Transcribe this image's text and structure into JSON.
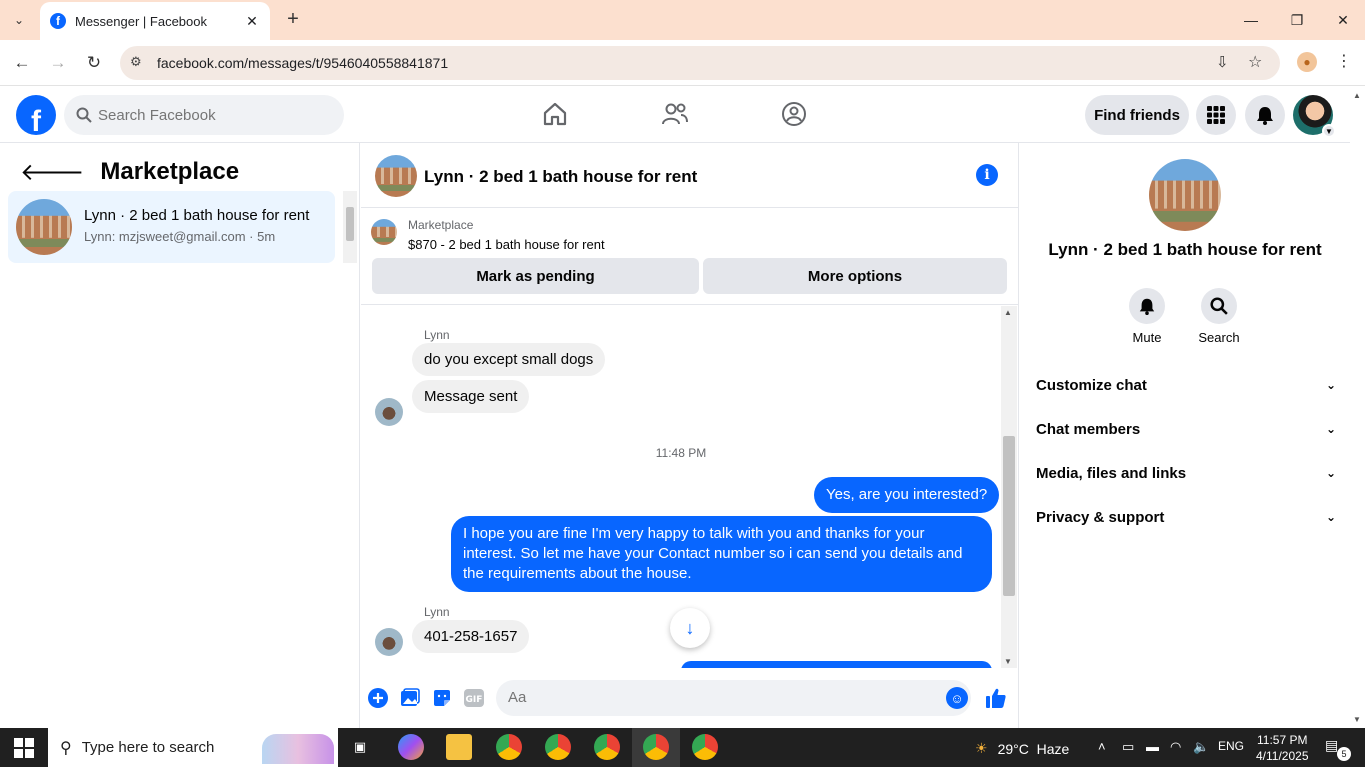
{
  "browser": {
    "tab_title": "Messenger | Facebook",
    "url": "facebook.com/messages/t/9546040558841871"
  },
  "fb_header": {
    "search_placeholder": "Search Facebook",
    "find_friends_label": "Find friends"
  },
  "left_panel": {
    "title": "Marketplace",
    "conversations": [
      {
        "title": "Lynn · 2 bed 1 bath house for rent",
        "preview": "Lynn: mzjsweet@gmail.com · 5m"
      }
    ]
  },
  "chat": {
    "header_name": "Lynn · 2 bed 1 bath house for rent",
    "marketplace_label": "Marketplace",
    "listing": "$870 - 2 bed 1 bath house for rent",
    "mark_pending_label": "Mark as pending",
    "more_options_label": "More options",
    "messages": {
      "sender_1": "Lynn",
      "in_1": "do you except small dogs",
      "in_2": "Message sent",
      "timestamp": "11:48 PM",
      "out_1": "Yes, are you interested?",
      "out_2": "I hope you are fine I'm very happy to talk with you and thanks for your interest. So let me have your Contact number so i can send you details and the requirements about the house.",
      "sender_2": "Lynn",
      "in_3": "401-258-1657"
    },
    "composer_placeholder": "Aa"
  },
  "right_panel": {
    "title": "Lynn · 2 bed 1 bath house for rent",
    "mute_label": "Mute",
    "search_label": "Search",
    "sections": [
      "Customize chat",
      "Chat members",
      "Media, files and links",
      "Privacy & support"
    ]
  },
  "taskbar": {
    "search_placeholder": "Type here to search",
    "weather": "29°C  Haze",
    "language": "ENG",
    "time": "11:57 PM",
    "date": "4/11/2025",
    "notification_count": "5"
  },
  "colors": {
    "fb_blue": "#0866ff",
    "tab_bar": "#fce0cf",
    "bubble_in": "#f0f0f0",
    "selected_conv": "#ebf5ff"
  }
}
